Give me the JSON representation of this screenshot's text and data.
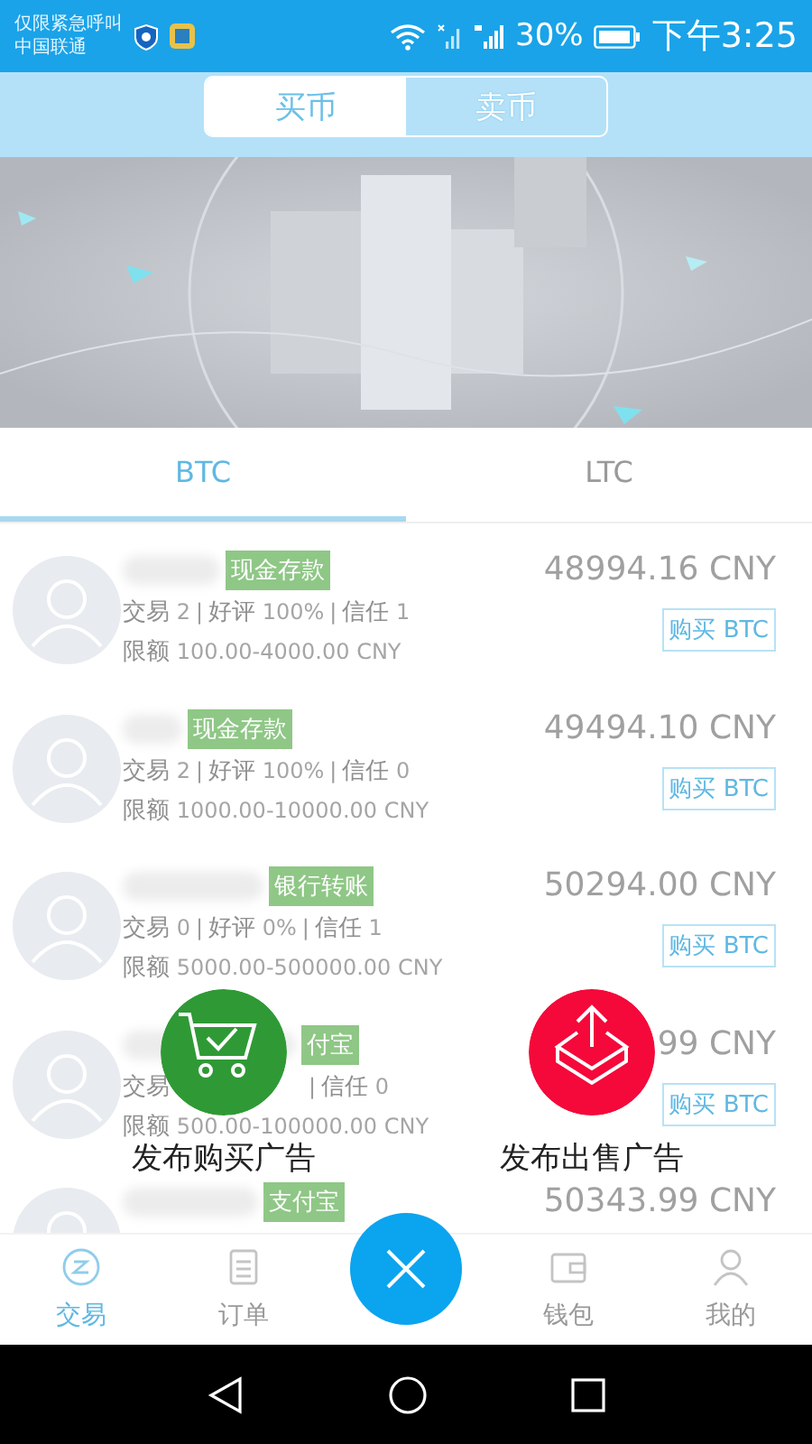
{
  "status_bar": {
    "carrier_line_1": "仅限紧急呼叫",
    "carrier_line_2": "中国联通",
    "battery": "30%",
    "time": "下午3:25"
  },
  "segment": [
    {
      "label": "买币",
      "selected": true
    },
    {
      "label": "卖币",
      "selected": false
    }
  ],
  "coin_tabs": [
    {
      "label": "BTC",
      "selected": true
    },
    {
      "label": "LTC",
      "selected": false
    }
  ],
  "offers": [
    {
      "tag": "现金存款",
      "stats": [
        {
          "label": "交易",
          "value": "2"
        },
        {
          "separator": "|",
          "label": "好评",
          "value": "100%"
        },
        {
          "separator": "|",
          "label": "信任",
          "value": "1"
        }
      ],
      "limit_label": "限额",
      "limit": "100.00-4000.00 CNY",
      "price": "48994.16 CNY",
      "button": "购买 BTC"
    },
    {
      "tag": "现金存款",
      "stats": [
        {
          "label": "交易",
          "value": "2"
        },
        {
          "separator": "|",
          "label": "好评",
          "value": "100%"
        },
        {
          "separator": "|",
          "label": "信任",
          "value": "0"
        }
      ],
      "limit_label": "限额",
      "limit": "1000.00-10000.00 CNY",
      "price": "49494.10 CNY",
      "button": "购买 BTC"
    },
    {
      "tag": "银行转账",
      "stats": [
        {
          "label": "交易",
          "value": "0"
        },
        {
          "separator": "|",
          "label": "好评",
          "value": "0%"
        },
        {
          "separator": "|",
          "label": "信任",
          "value": "1"
        }
      ],
      "limit_label": "限额",
      "limit": "5000.00-500000.00 CNY",
      "price": "50294.00 CNY",
      "button": "购买 BTC"
    },
    {
      "tag": "付宝",
      "stats": [
        {
          "label": "交易"
        },
        {
          "separator": "|",
          "label": "信任",
          "value": "0"
        }
      ],
      "limit_label": "限额",
      "limit": "500.00-100000.00 CNY",
      "price": "99 CNY",
      "button": "购买 BTC"
    },
    {
      "tag": "支付宝",
      "price": "50343.99 CNY"
    }
  ],
  "fab_menu": [
    {
      "kind": "buy",
      "label": "发布购买广告"
    },
    {
      "kind": "sell",
      "label": "发布出售广告"
    }
  ],
  "bottom_nav": [
    {
      "kind": "trade",
      "label": "交易",
      "selected": true
    },
    {
      "kind": "orders",
      "label": "订单",
      "selected": false
    },
    {
      "kind": "close"
    },
    {
      "kind": "wallet",
      "label": "钱包",
      "selected": false
    },
    {
      "kind": "me",
      "label": "我的",
      "selected": false
    }
  ]
}
